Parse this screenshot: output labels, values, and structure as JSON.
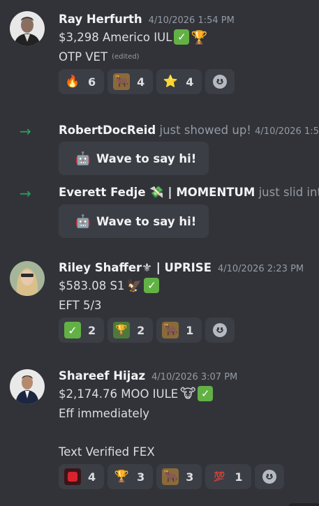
{
  "colors": {
    "background": "#323339",
    "reaction_bg": "#3c3e45",
    "username": "#f2f3f5",
    "timestamp": "#949ba4",
    "join_arrow": "#23a55a",
    "check_green": "#62b145"
  },
  "messages": [
    {
      "author": "Ray Herfurth",
      "timestamp": "4/10/2026 1:54 PM",
      "lines": [
        "$3,298 Americo IUL",
        "OTP VET"
      ],
      "edited_label": "(edited)",
      "reactions": [
        {
          "emoji": "🔥",
          "count": "6",
          "icon": "fire-icon"
        },
        {
          "emoji": "🐂",
          "count": "4",
          "icon": "bull-gold-icon"
        },
        {
          "emoji": "⭐",
          "count": "4",
          "icon": "gold-star-icon"
        }
      ]
    },
    {
      "author": "Riley Shaffer⚜ | UPRISE",
      "timestamp": "4/10/2026 2:23 PM",
      "lines": [
        "$583.08 S1",
        "EFT 5/3"
      ],
      "reactions": [
        {
          "emoji": "✓",
          "count": "2",
          "icon": "check-icon"
        },
        {
          "emoji": "💚",
          "count": "2",
          "icon": "green-trophy-icon"
        },
        {
          "emoji": "🐂",
          "count": "1",
          "icon": "bull-gold-icon"
        }
      ]
    },
    {
      "author": "Shareef Hijaz",
      "timestamp": "4/10/2026 3:07 PM",
      "lines": [
        "$2,174.76 MOO IULE",
        "Eff immediately",
        "Text Verified FEX"
      ],
      "reactions": [
        {
          "emoji": "🟥",
          "count": "4",
          "icon": "red-gem-icon"
        },
        {
          "emoji": "🏆",
          "count": "3",
          "icon": "trophy-icon"
        },
        {
          "emoji": "🐂",
          "count": "3",
          "icon": "bull-gold-icon"
        },
        {
          "emoji": "💯",
          "count": "1",
          "icon": "hundred-icon"
        }
      ]
    }
  ],
  "joins": [
    {
      "name": "RobertDocReid",
      "rest": " just showed up! ",
      "timestamp": "4/10/2026 1:58",
      "wave_label": "Wave to say hi!",
      "wave_icon": "🤖"
    },
    {
      "name": "Everett Fedje 💸 | MOMENTUM",
      "rest": " just slid into",
      "wave_label": "Wave to say hi!",
      "wave_icon": "🤖"
    }
  ]
}
